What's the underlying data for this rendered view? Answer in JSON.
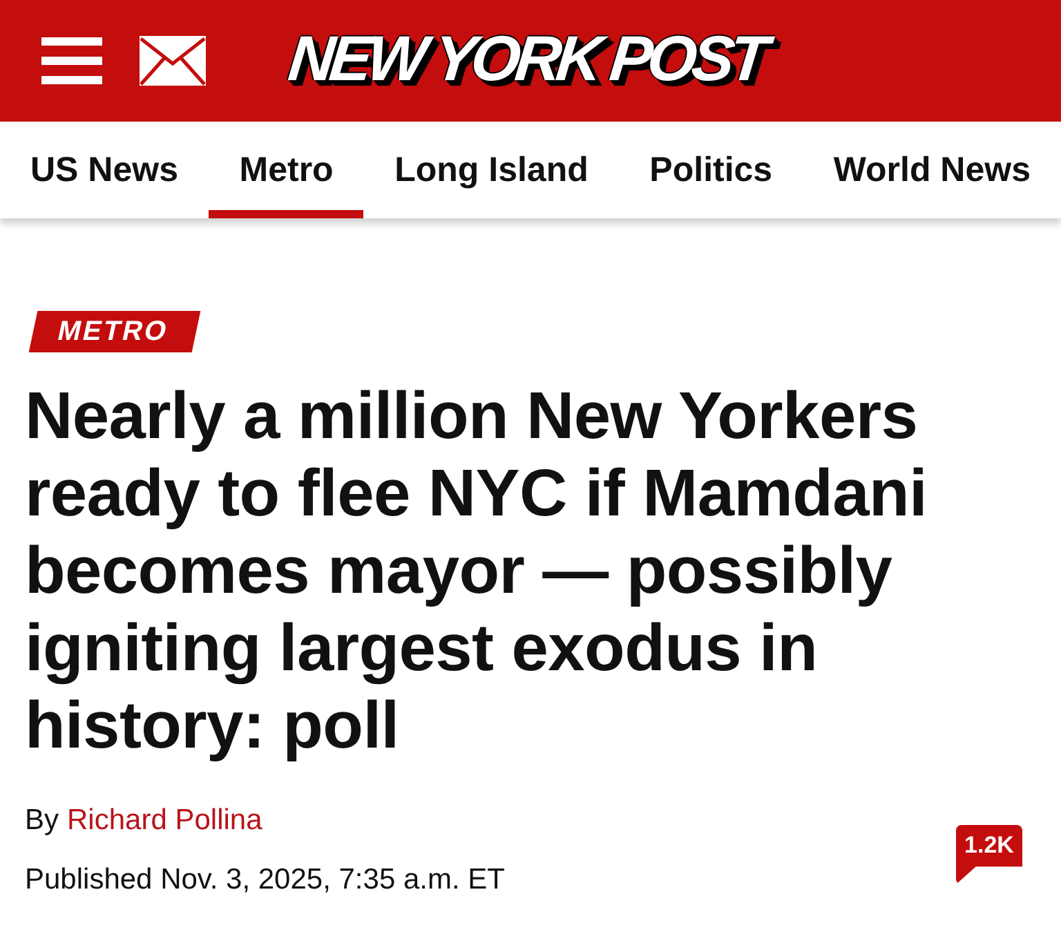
{
  "header": {
    "logo": "NEW YORK POST"
  },
  "nav": {
    "tabs": [
      {
        "label": "US News",
        "selected": false
      },
      {
        "label": "Metro",
        "selected": true
      },
      {
        "label": "Long Island",
        "selected": false
      },
      {
        "label": "Politics",
        "selected": false
      },
      {
        "label": "World News",
        "selected": false
      }
    ]
  },
  "article": {
    "section_tag": "METRO",
    "headline": "Nearly a million New Yorkers ready to flee NYC if Mamdani becomes mayor — possibly igniting largest exodus in history: poll",
    "byline": {
      "prefix": "By",
      "author": "Richard Pollina"
    },
    "published": "Published Nov. 3, 2025, 7:35 a.m. ET",
    "comment_count": "1.2K"
  }
}
